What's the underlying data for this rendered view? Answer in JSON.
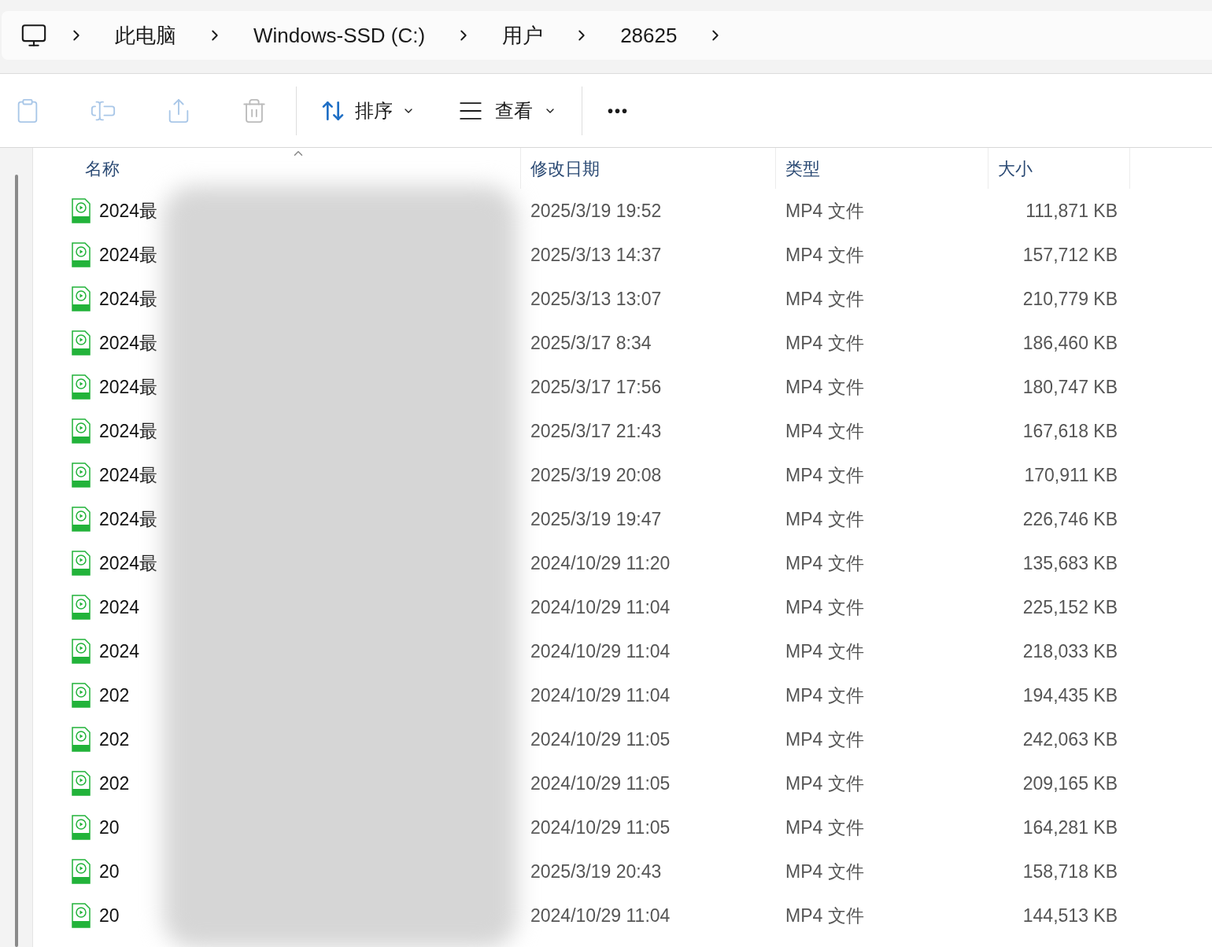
{
  "breadcrumb": [
    "此电脑",
    "Windows-SSD (C:)",
    "用户",
    "28625"
  ],
  "toolbar": {
    "sort": "排序",
    "view": "查看",
    "more": "•••"
  },
  "table": {
    "columns": [
      "名称",
      "修改日期",
      "类型",
      "大小"
    ],
    "rows": [
      {
        "name": "2024最",
        "date": "2025/3/19 19:52",
        "type": "MP4 文件",
        "size": "111,871 KB"
      },
      {
        "name": "2024最",
        "date": "2025/3/13 14:37",
        "type": "MP4 文件",
        "size": "157,712 KB"
      },
      {
        "name": "2024最",
        "date": "2025/3/13 13:07",
        "type": "MP4 文件",
        "size": "210,779 KB"
      },
      {
        "name": "2024最",
        "date": "2025/3/17 8:34",
        "type": "MP4 文件",
        "size": "186,460 KB"
      },
      {
        "name": "2024最",
        "date": "2025/3/17 17:56",
        "type": "MP4 文件",
        "size": "180,747 KB"
      },
      {
        "name": "2024最",
        "date": "2025/3/17 21:43",
        "type": "MP4 文件",
        "size": "167,618 KB"
      },
      {
        "name": "2024最",
        "date": "2025/3/19 20:08",
        "type": "MP4 文件",
        "size": "170,911 KB"
      },
      {
        "name": "2024最",
        "date": "2025/3/19 19:47",
        "type": "MP4 文件",
        "size": "226,746 KB"
      },
      {
        "name": "2024最",
        "date": "2024/10/29 11:20",
        "type": "MP4 文件",
        "size": "135,683 KB"
      },
      {
        "name": "2024",
        "date": "2024/10/29 11:04",
        "type": "MP4 文件",
        "size": "225,152 KB"
      },
      {
        "name": "2024",
        "date": "2024/10/29 11:04",
        "type": "MP4 文件",
        "size": "218,033 KB"
      },
      {
        "name": "202",
        "date": "2024/10/29 11:04",
        "type": "MP4 文件",
        "size": "194,435 KB"
      },
      {
        "name": "202",
        "date": "2024/10/29 11:05",
        "type": "MP4 文件",
        "size": "242,063 KB"
      },
      {
        "name": "202",
        "date": "2024/10/29 11:05",
        "type": "MP4 文件",
        "size": "209,165 KB"
      },
      {
        "name": "20",
        "date": "2024/10/29 11:05",
        "type": "MP4 文件",
        "size": "164,281 KB"
      },
      {
        "name": "20",
        "date": "2025/3/19 20:43",
        "type": "MP4 文件",
        "size": "158,718 KB"
      },
      {
        "name": "20",
        "date": "2024/10/29 11:04",
        "type": "MP4 文件",
        "size": "144,513 KB"
      }
    ]
  }
}
